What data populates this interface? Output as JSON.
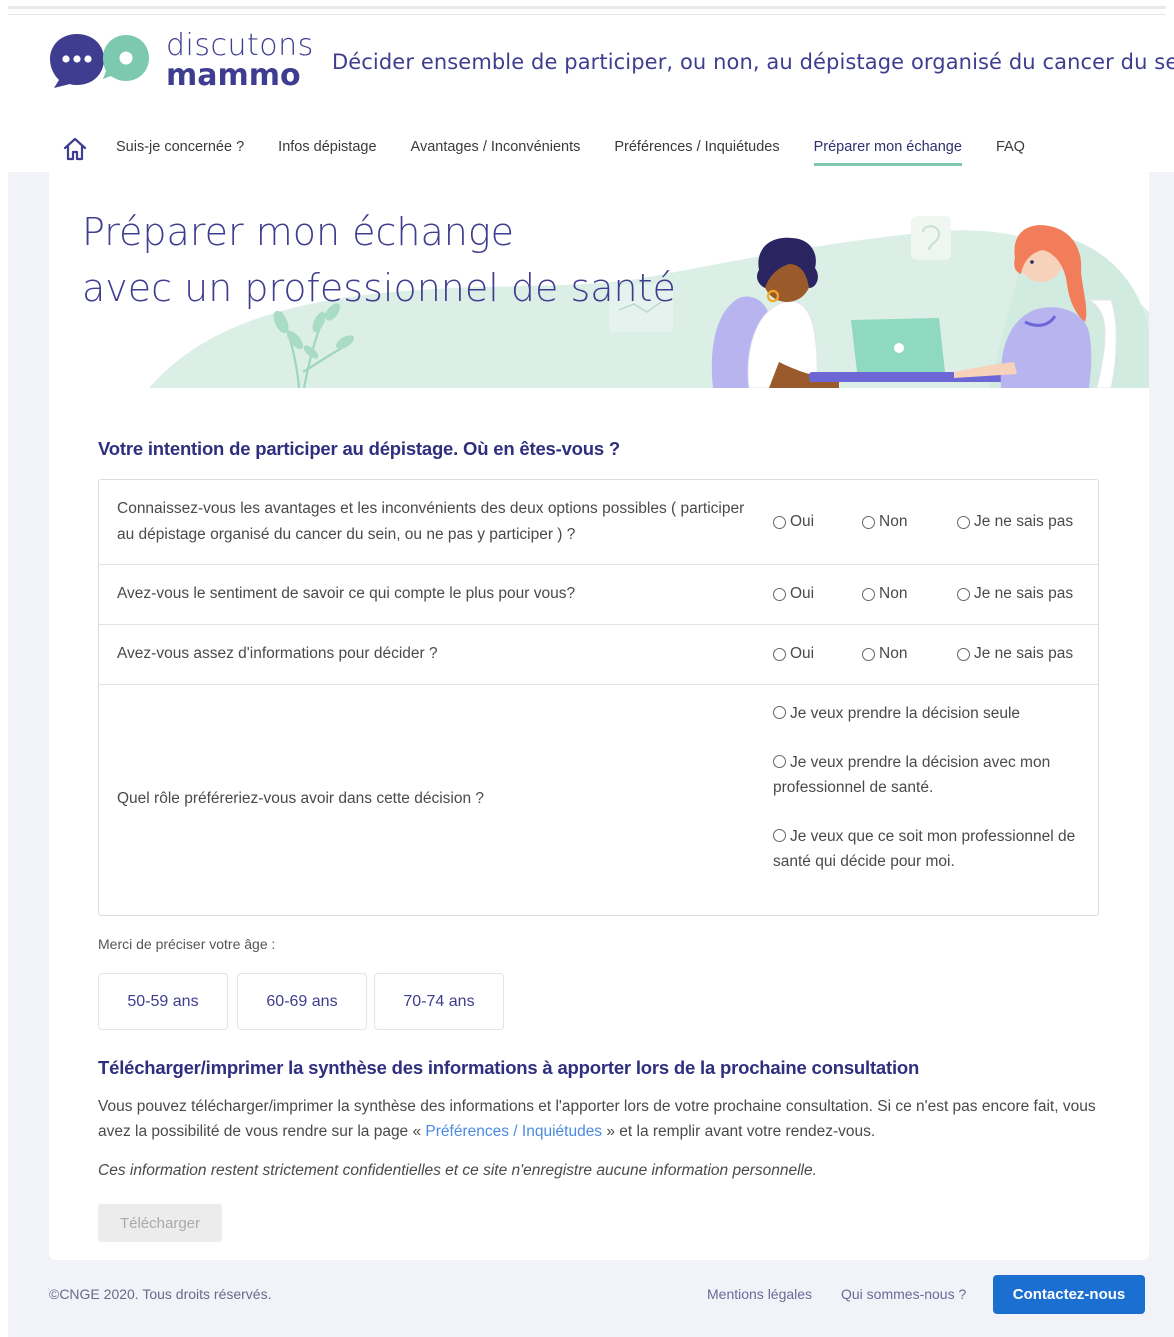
{
  "header": {
    "logo_word1": "discutons",
    "logo_word2": "mammo",
    "tagline": "Décider ensemble de participer, ou non, au dépistage organisé du cancer du sein"
  },
  "nav": {
    "items": [
      {
        "label": "Suis-je concernée ?"
      },
      {
        "label": "Infos dépistage"
      },
      {
        "label": "Avantages / Inconvénients"
      },
      {
        "label": "Préférences / Inquiétudes"
      },
      {
        "label": "Préparer mon échange"
      },
      {
        "label": "FAQ"
      }
    ],
    "active_index": 4
  },
  "hero": {
    "title_line1": "Préparer mon échange",
    "title_line2": "avec un professionnel de santé"
  },
  "intention": {
    "title": "Votre intention de participer au dépistage. Où en êtes-vous ?",
    "options": {
      "yes": "Oui",
      "no": "Non",
      "dunno": "Je ne sais pas"
    },
    "questions": [
      {
        "text": "Connaissez-vous les avantages et les inconvénients des deux options possibles ( participer au dépistage organisé du cancer du sein, ou ne pas y participer ) ?"
      },
      {
        "text": "Avez-vous le sentiment de savoir ce qui compte le plus pour vous?"
      },
      {
        "text": "Avez-vous assez d'informations pour décider ?"
      }
    ],
    "role_question": "Quel rôle préféreriez-vous avoir dans cette décision ?",
    "role_options": [
      "Je veux prendre la décision seule",
      "Je veux prendre la décision avec mon professionnel de santé.",
      "Je veux que ce soit mon professionnel de santé qui décide pour moi."
    ]
  },
  "age": {
    "label": "Merci de préciser votre âge :",
    "options": [
      "50-59 ans",
      "60-69 ans",
      "70-74 ans"
    ]
  },
  "download": {
    "title": "Télécharger/imprimer la synthèse des informations à apporter lors de la prochaine consultation",
    "para_before": "Vous pouvez télécharger/imprimer la synthèse des informations et l'apporter lors de votre prochaine consultation. Si ce n'est pas encore fait, vous avez la possibilité de vous rendre sur la page « ",
    "para_link": "Préférences / Inquiétudes",
    "para_after": " » et la remplir avant votre rendez-vous.",
    "note": "Ces information restent strictement confidentielles et ce site n'enregistre aucune information personnelle.",
    "button": "Télécharger"
  },
  "footer": {
    "copyright": "©CNGE 2020. Tous droits réservés.",
    "links": [
      "Mentions légales",
      "Qui sommes-nous ?"
    ],
    "contact": "Contactez-nous"
  },
  "colors": {
    "brand": "#3f3d8f",
    "accent_green": "#7cc9b0",
    "link_blue": "#4a8ae0",
    "contact_blue": "#1b6fd0"
  },
  "icons": [
    "home-icon",
    "chat-bubble-logo-icon",
    "radio-icon"
  ]
}
